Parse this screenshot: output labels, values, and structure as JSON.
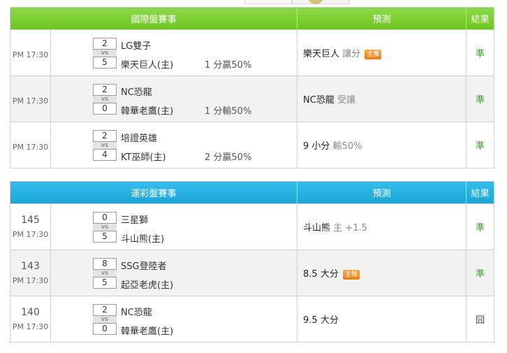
{
  "intl": {
    "header": {
      "event": "國際盤賽事",
      "predict": "預測",
      "result": "結果"
    },
    "rows": [
      {
        "no": "",
        "time": "PM 17:30",
        "score1": "2",
        "score2": "5",
        "vs": "VS",
        "team1": "LG雙子",
        "team2": "樂天巨人(主)",
        "handicap": "1 分贏50%",
        "pick": "樂天巨人",
        "pick_sub": "讓分",
        "badge": "主推",
        "result": "準",
        "result_type": "win"
      },
      {
        "no": "",
        "time": "PM 17:30",
        "score1": "2",
        "score2": "0",
        "vs": "VS",
        "team1": "NC恐龍",
        "team2": "韓華老鷹(主)",
        "handicap": "1 分輸50%",
        "pick": "NC恐龍",
        "pick_sub": "受讓",
        "badge": "",
        "result": "準",
        "result_type": "win"
      },
      {
        "no": "",
        "time": "PM 17:30",
        "score1": "2",
        "score2": "4",
        "vs": "VS",
        "team1": "培證英雄",
        "team2": "KT巫師(主)",
        "handicap": "2 分贏50%",
        "pick": "9 小分",
        "pick_sub": "輸50%",
        "badge": "",
        "result": "準",
        "result_type": "win"
      }
    ]
  },
  "lotto": {
    "header": {
      "event": "運彩盤賽事",
      "predict": "預測",
      "result": "結果"
    },
    "rows": [
      {
        "no": "145",
        "time": "PM 17:30",
        "score1": "0",
        "score2": "5",
        "vs": "VS",
        "team1": "三星獅",
        "team2": "斗山熊(主)",
        "handicap": "",
        "pick": "斗山熊",
        "pick_sub": "主 +1.5",
        "badge": "",
        "result": "準",
        "result_type": "win"
      },
      {
        "no": "143",
        "time": "PM 17:30",
        "score1": "8",
        "score2": "5",
        "vs": "VS",
        "team1": "SSG登陸者",
        "team2": "起亞老虎(主)",
        "handicap": "",
        "pick": "8.5 大分",
        "pick_sub": "",
        "badge": "主推",
        "result": "準",
        "result_type": "win"
      },
      {
        "no": "140",
        "time": "PM 17:30",
        "score1": "2",
        "score2": "0",
        "vs": "VS",
        "team1": "NC恐龍",
        "team2": "韓華老鷹(主)",
        "handicap": "",
        "pick": "9.5 大分",
        "pick_sub": "",
        "badge": "",
        "result": "囧",
        "result_type": "lose"
      }
    ]
  }
}
